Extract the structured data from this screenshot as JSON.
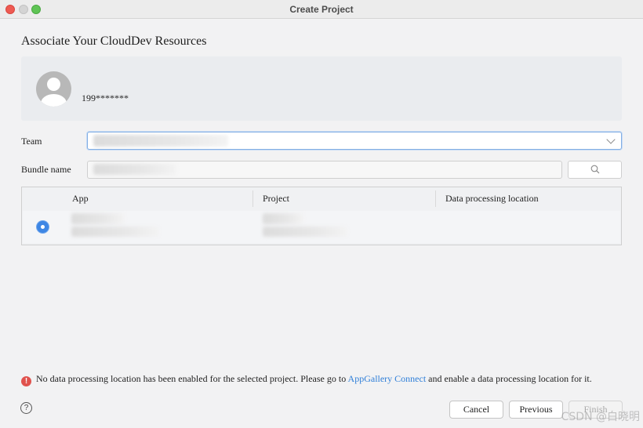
{
  "window": {
    "title": "Create Project"
  },
  "heading": "Associate Your CloudDev Resources",
  "account": {
    "name": "199*******"
  },
  "form": {
    "team_label": "Team",
    "bundle_label": "Bundle name"
  },
  "table": {
    "columns": [
      "App",
      "Project",
      "Data processing location"
    ]
  },
  "error": {
    "text_before": "No data processing location has been enabled for the selected project. Please go to ",
    "link": "AppGallery Connect",
    "text_after": " and enable a data processing location for it."
  },
  "footer": {
    "help": "?",
    "cancel": "Cancel",
    "previous": "Previous",
    "finish": "Finish"
  },
  "watermark": "CSDN @白晓明",
  "colors": {
    "accent": "#3e86e4",
    "error": "#e0524d",
    "link": "#2f7fd8"
  }
}
